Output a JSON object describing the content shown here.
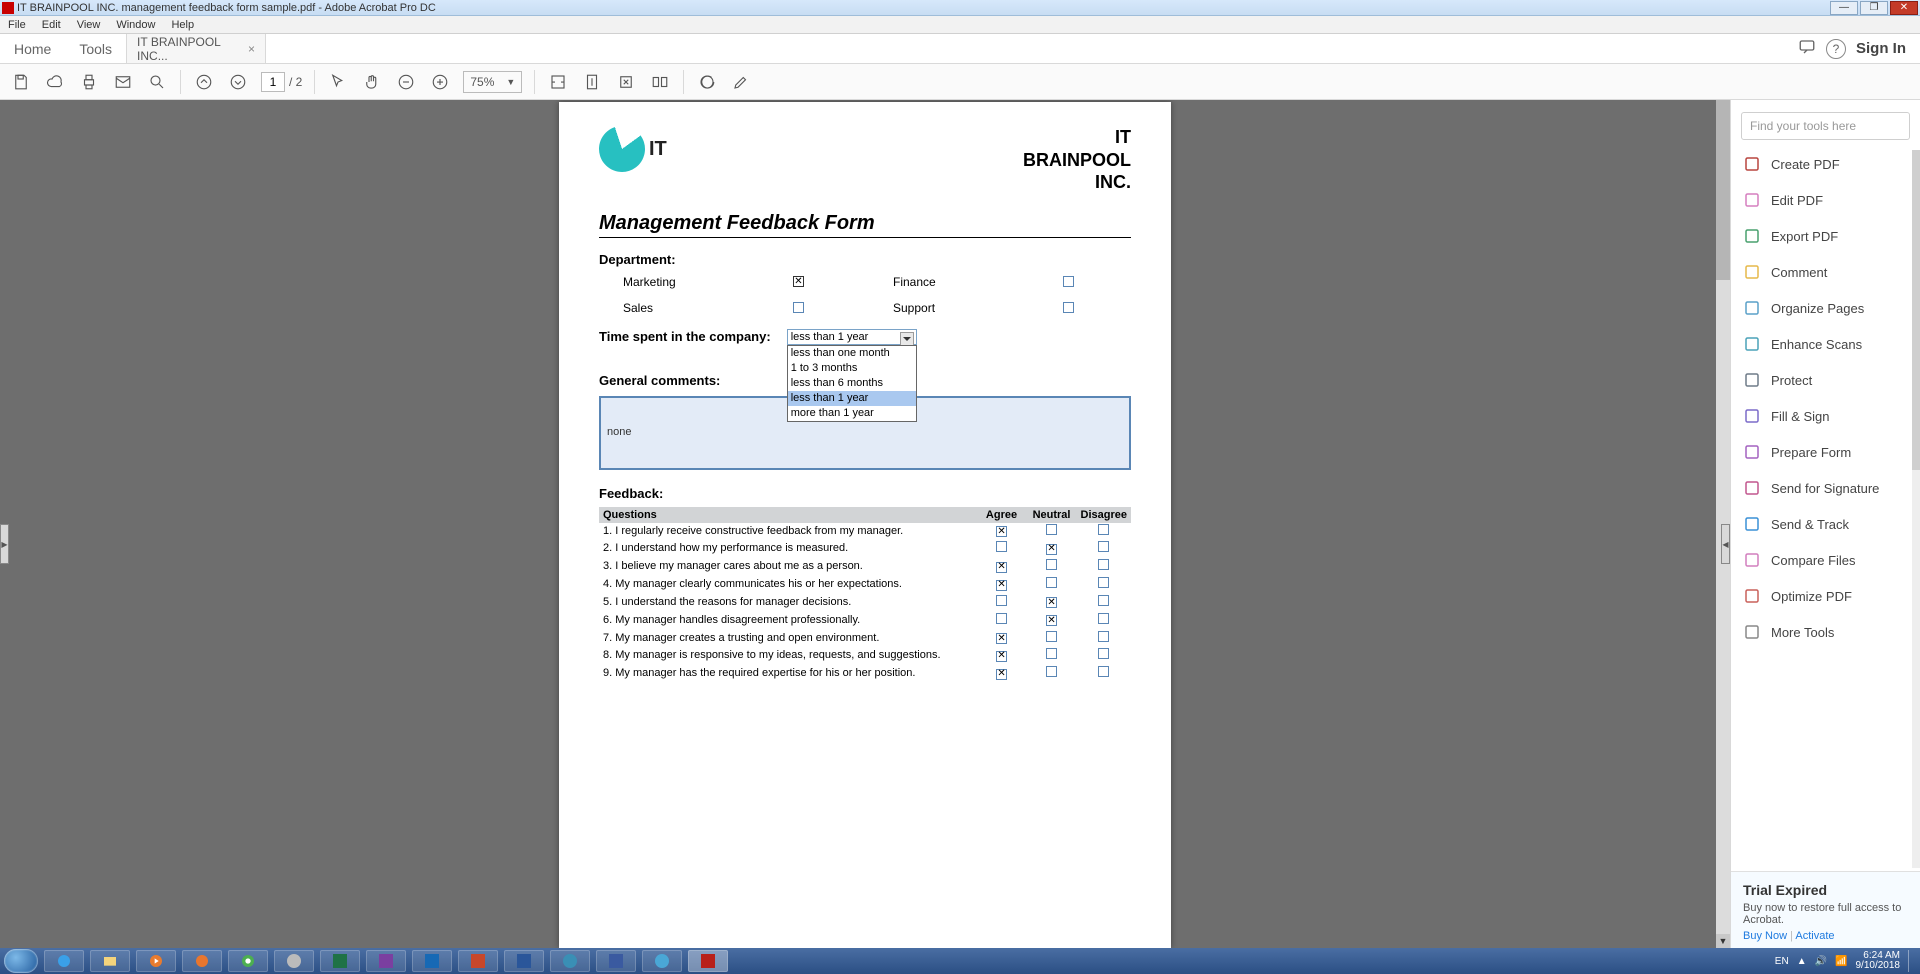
{
  "titlebar": {
    "title": "IT BRAINPOOL INC. management feedback form sample.pdf - Adobe Acrobat Pro DC"
  },
  "menubar": [
    "File",
    "Edit",
    "View",
    "Window",
    "Help"
  ],
  "tabrow": {
    "home": "Home",
    "tools": "Tools",
    "doc_tab": "IT BRAINPOOL INC...",
    "sign_in": "Sign In"
  },
  "toolbar": {
    "page_current": "1",
    "page_total": "/ 2",
    "zoom": "75%"
  },
  "doc": {
    "brand_it": "IT",
    "brand_lines": [
      "IT",
      "BRAINPOOL",
      "INC."
    ],
    "title": "Management Feedback Form",
    "department_heading": "Department:",
    "depts": {
      "marketing": "Marketing",
      "finance": "Finance",
      "sales": "Sales",
      "support": "Support"
    },
    "time_label": "Time spent in the company:",
    "time_selected": "less than 1 year",
    "time_options": [
      "less than one month",
      "1 to 3 months",
      "less than 6 months",
      "less than 1 year",
      "more than 1 year"
    ],
    "general_comments_label": "General comments:",
    "general_comments_value": "none",
    "feedback_heading": "Feedback:",
    "table": {
      "col_q": "Questions",
      "col_agree": "Agree",
      "col_neutral": "Neutral",
      "col_disagree": "Disagree",
      "rows": [
        {
          "q": "1. I regularly receive constructive feedback from my manager.",
          "a": "agree"
        },
        {
          "q": "2. I understand how my performance is measured.",
          "a": "neutral"
        },
        {
          "q": "3. I believe my manager cares about me as a person.",
          "a": "agree"
        },
        {
          "q": "4. My manager clearly communicates his or her expectations.",
          "a": "agree"
        },
        {
          "q": "5. I understand the reasons for manager decisions.",
          "a": "neutral"
        },
        {
          "q": "6. My manager handles disagreement professionally.",
          "a": "neutral"
        },
        {
          "q": "7. My manager creates a trusting and open environment.",
          "a": "agree"
        },
        {
          "q": "8. My manager is responsive to my ideas, requests, and suggestions.",
          "a": "agree"
        },
        {
          "q": "9. My manager has the required expertise for his or her position.",
          "a": "agree"
        }
      ]
    }
  },
  "tools_pane": {
    "search_placeholder": "Find your tools here",
    "items": [
      {
        "label": "Create PDF",
        "color": "#b8453f"
      },
      {
        "label": "Edit PDF",
        "color": "#d57fbf"
      },
      {
        "label": "Export PDF",
        "color": "#49a06e"
      },
      {
        "label": "Comment",
        "color": "#e6b94a"
      },
      {
        "label": "Organize Pages",
        "color": "#5aa0c8"
      },
      {
        "label": "Enhance Scans",
        "color": "#4aa2b8"
      },
      {
        "label": "Protect",
        "color": "#6f7b88"
      },
      {
        "label": "Fill & Sign",
        "color": "#7b6bc9"
      },
      {
        "label": "Prepare Form",
        "color": "#a462c0"
      },
      {
        "label": "Send for Signature",
        "color": "#c2578e"
      },
      {
        "label": "Send & Track",
        "color": "#3a90d6"
      },
      {
        "label": "Compare Files",
        "color": "#d27fbe"
      },
      {
        "label": "Optimize PDF",
        "color": "#c9605a"
      },
      {
        "label": "More Tools",
        "color": "#888888"
      }
    ],
    "trial": {
      "title": "Trial Expired",
      "body": "Buy now to restore full access to Acrobat.",
      "buy": "Buy Now",
      "activate": "Activate"
    }
  },
  "tray": {
    "lang": "EN",
    "time": "6:24 AM",
    "date": "9/10/2018"
  }
}
